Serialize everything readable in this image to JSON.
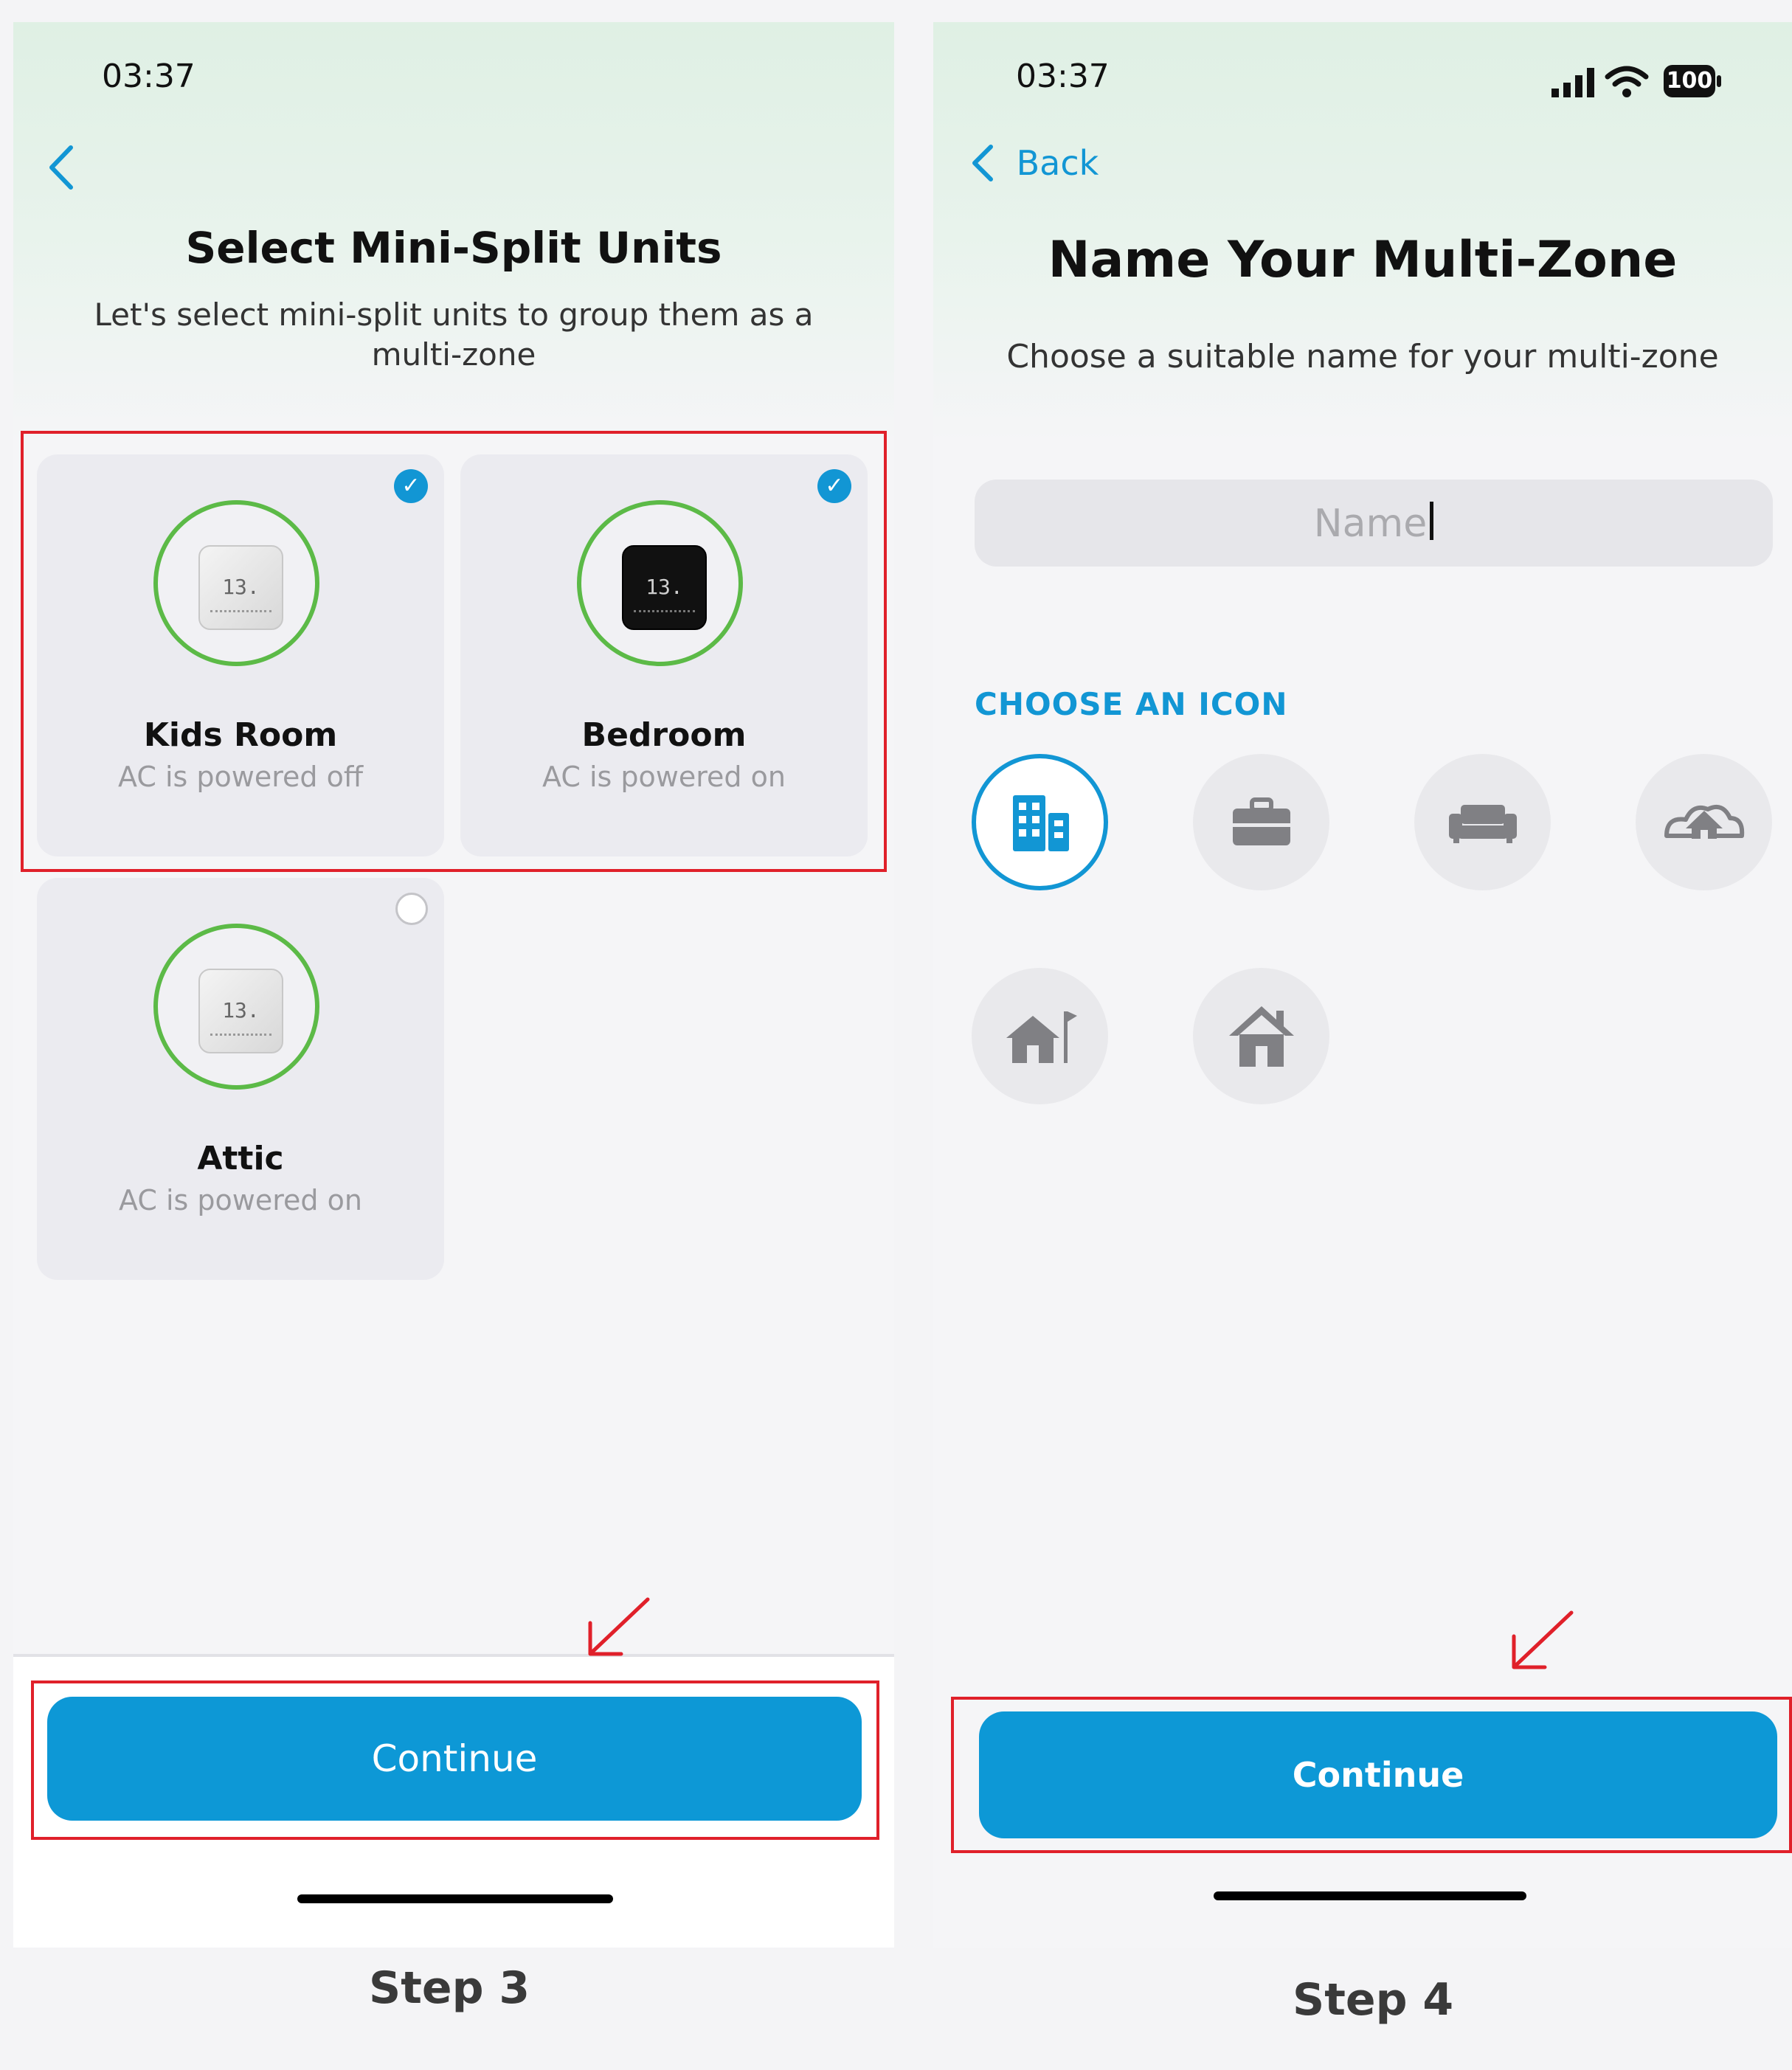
{
  "step3": {
    "status_time": "03:37",
    "back_icon": "chevron-left-icon",
    "title": "Select Mini-Split Units",
    "subtitle": "Let's select mini-split units to group them as a multi-zone",
    "units": [
      {
        "name": "Kids Room",
        "status": "AC is powered off",
        "selected": true,
        "thermostat": "light",
        "readout": "13."
      },
      {
        "name": "Bedroom",
        "status": "AC is powered on",
        "selected": true,
        "thermostat": "dark",
        "readout": "13."
      },
      {
        "name": "Attic",
        "status": "AC is powered on",
        "selected": false,
        "thermostat": "light",
        "readout": "13."
      }
    ],
    "continue_label": "Continue",
    "step_label": "Step 3"
  },
  "step4": {
    "status_time": "03:37",
    "battery": "100",
    "back_label": "Back",
    "title": "Name Your Multi-Zone",
    "subtitle": "Choose a suitable name for your multi-zone",
    "name_placeholder": "Name",
    "choose_icon_label": "CHOOSE AN ICON",
    "icons": [
      "building-icon",
      "briefcase-icon",
      "sofa-icon",
      "cloud-house-icon",
      "house-flag-icon",
      "house-icon"
    ],
    "selected_icon": "building-icon",
    "continue_label": "Continue",
    "step_label": "Step 4"
  },
  "colors": {
    "accent": "#0d98d6",
    "check": "#1296d4",
    "ring": "#5cba47",
    "highlight": "#e0202a",
    "header_gradient": "#dff0e4"
  }
}
